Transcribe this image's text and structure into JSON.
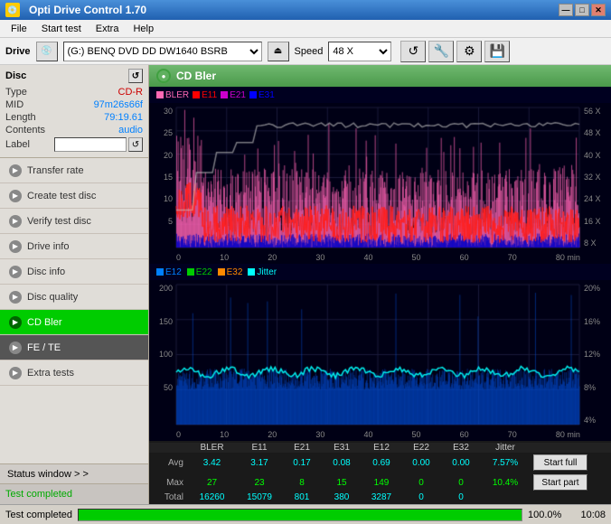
{
  "titlebar": {
    "title": "Opti Drive Control 1.70",
    "icon": "💿",
    "controls": [
      "—",
      "□",
      "✕"
    ]
  },
  "menubar": {
    "items": [
      "File",
      "Start test",
      "Extra",
      "Help"
    ]
  },
  "drivebar": {
    "label": "Drive",
    "drive_value": "(G:)  BENQ DVD DD DW1640 BSRB",
    "speed_label": "Speed",
    "speed_value": "48 X"
  },
  "disc": {
    "header": "Disc",
    "type_label": "Type",
    "type_value": "CD-R",
    "mid_label": "MID",
    "mid_value": "97m26s66f",
    "length_label": "Length",
    "length_value": "79:19.61",
    "contents_label": "Contents",
    "contents_value": "audio",
    "label_label": "Label"
  },
  "left_menu": {
    "items": [
      {
        "id": "transfer-rate",
        "label": "Transfer rate",
        "active": false
      },
      {
        "id": "create-test-disc",
        "label": "Create test disc",
        "active": false
      },
      {
        "id": "verify-test-disc",
        "label": "Verify test disc",
        "active": false
      },
      {
        "id": "drive-info",
        "label": "Drive info",
        "active": false
      },
      {
        "id": "disc-info",
        "label": "Disc info",
        "active": false
      },
      {
        "id": "disc-quality",
        "label": "Disc quality",
        "active": false
      },
      {
        "id": "cd-bler",
        "label": "CD Bler",
        "active": true
      },
      {
        "id": "fe-te",
        "label": "FE / TE",
        "active": false
      },
      {
        "id": "extra-tests",
        "label": "Extra tests",
        "active": false
      }
    ],
    "status_window": "Status window > >",
    "status_text": "Test completed"
  },
  "chart": {
    "title": "CD Bler",
    "top_legend": [
      {
        "label": "BLER",
        "color": "#ff69b4"
      },
      {
        "label": "E11",
        "color": "#ff0000"
      },
      {
        "label": "E21",
        "color": "#cc00cc"
      },
      {
        "label": "E31",
        "color": "#0000ff"
      }
    ],
    "bottom_legend": [
      {
        "label": "E12",
        "color": "#0080ff"
      },
      {
        "label": "E22",
        "color": "#00cc00"
      },
      {
        "label": "E32",
        "color": "#ff8800"
      },
      {
        "label": "Jitter",
        "color": "#00ffff"
      }
    ],
    "x_labels": [
      "0",
      "10",
      "20",
      "30",
      "40",
      "50",
      "60",
      "70",
      "80"
    ],
    "top_y_labels": [
      "56 X",
      "48 X",
      "40 X",
      "32 X",
      "24 X",
      "16 X",
      "8 X"
    ],
    "top_y_axis": [
      "30",
      "25",
      "20",
      "15",
      "10",
      "5"
    ],
    "bottom_y_labels": [
      "20%",
      "16%",
      "12%",
      "8%",
      "4%"
    ],
    "bottom_y_axis": [
      "200",
      "150",
      "100",
      "50"
    ]
  },
  "stats": {
    "headers": [
      "BLER",
      "E11",
      "E21",
      "E31",
      "E12",
      "E22",
      "E32",
      "Jitter"
    ],
    "avg": [
      "3.42",
      "3.17",
      "0.17",
      "0.08",
      "0.69",
      "0.00",
      "0.00",
      "7.57%"
    ],
    "max": [
      "27",
      "23",
      "8",
      "15",
      "149",
      "0",
      "0",
      "10.4%"
    ],
    "total": [
      "16260",
      "15079",
      "801",
      "380",
      "3287",
      "0",
      "0",
      ""
    ],
    "btn_full": "Start full",
    "btn_part": "Start part"
  },
  "statusbar": {
    "completed_text": "Test completed",
    "progress": "100.0%",
    "time": "10:08"
  }
}
